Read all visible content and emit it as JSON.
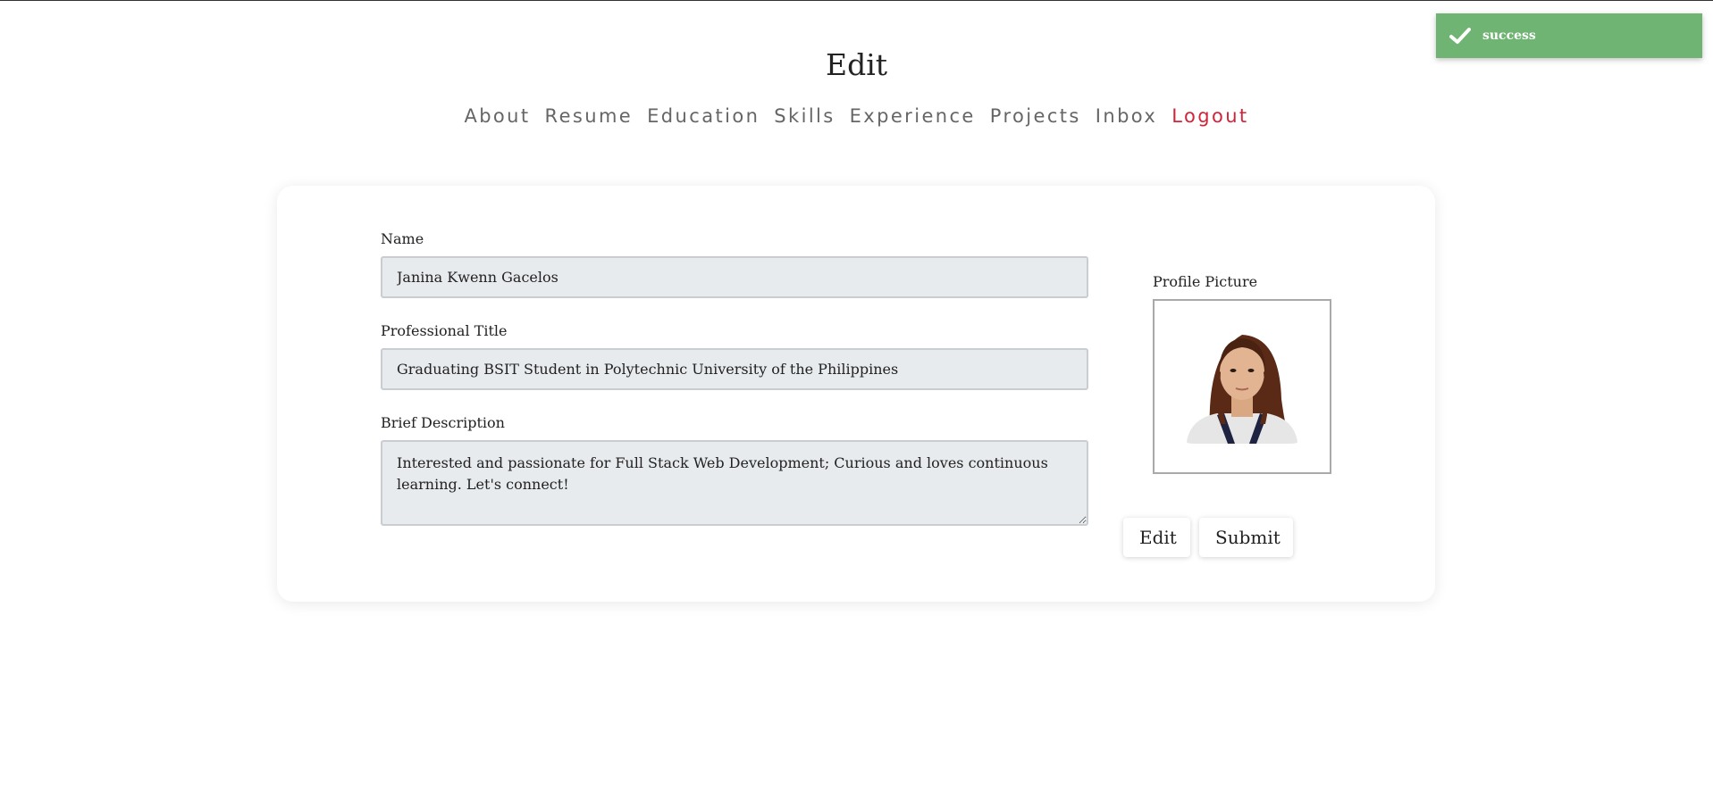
{
  "toast": {
    "message": "success",
    "icon": "check-icon",
    "color": "#6fb473"
  },
  "header": {
    "title": "Edit"
  },
  "nav": {
    "items": [
      {
        "label": "About"
      },
      {
        "label": "Resume"
      },
      {
        "label": "Education"
      },
      {
        "label": "Skills"
      },
      {
        "label": "Experience"
      },
      {
        "label": "Projects"
      },
      {
        "label": "Inbox"
      },
      {
        "label": "Logout",
        "color": "#d0243a"
      }
    ]
  },
  "form": {
    "name_label": "Name",
    "name_value": "Janina Kwenn Gacelos",
    "title_label": "Professional Title",
    "title_value": "Graduating BSIT Student in Polytechnic University of the Philippines",
    "description_label": "Brief Description",
    "description_value": "Interested and passionate for Full Stack Web Development; Curious and loves continuous learning. Let's connect!",
    "picture_label": "Profile Picture",
    "edit_label": "Edit",
    "submit_label": "Submit"
  }
}
